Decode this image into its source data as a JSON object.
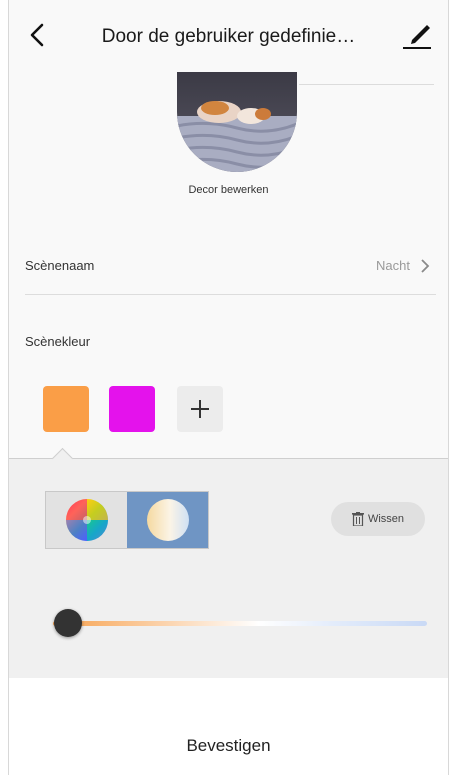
{
  "header": {
    "title": "Door de gebruiker gedefinie…",
    "back_icon": "chevron-left-icon",
    "edit_icon": "pencil-icon"
  },
  "decor": {
    "label": "Decor bewerken"
  },
  "scene_name": {
    "label": "Scènenaam",
    "value": "Nacht"
  },
  "scene_color": {
    "label": "Scènekleur",
    "swatches": [
      {
        "color": "#fa9e47"
      },
      {
        "color": "#e412ec"
      }
    ],
    "add_icon": "plus-icon"
  },
  "color_panel": {
    "modes": [
      "color-wheel-icon",
      "white-temperature-icon"
    ],
    "active_mode": 1,
    "clear_label": "Wissen",
    "slider_value": 0.04
  },
  "footer": {
    "confirm_label": "Bevestigen"
  },
  "colors": {
    "accent_blue": "#6f95c4",
    "slider_warm": "#f7a14d",
    "slider_cool": "#c9d9f5"
  }
}
